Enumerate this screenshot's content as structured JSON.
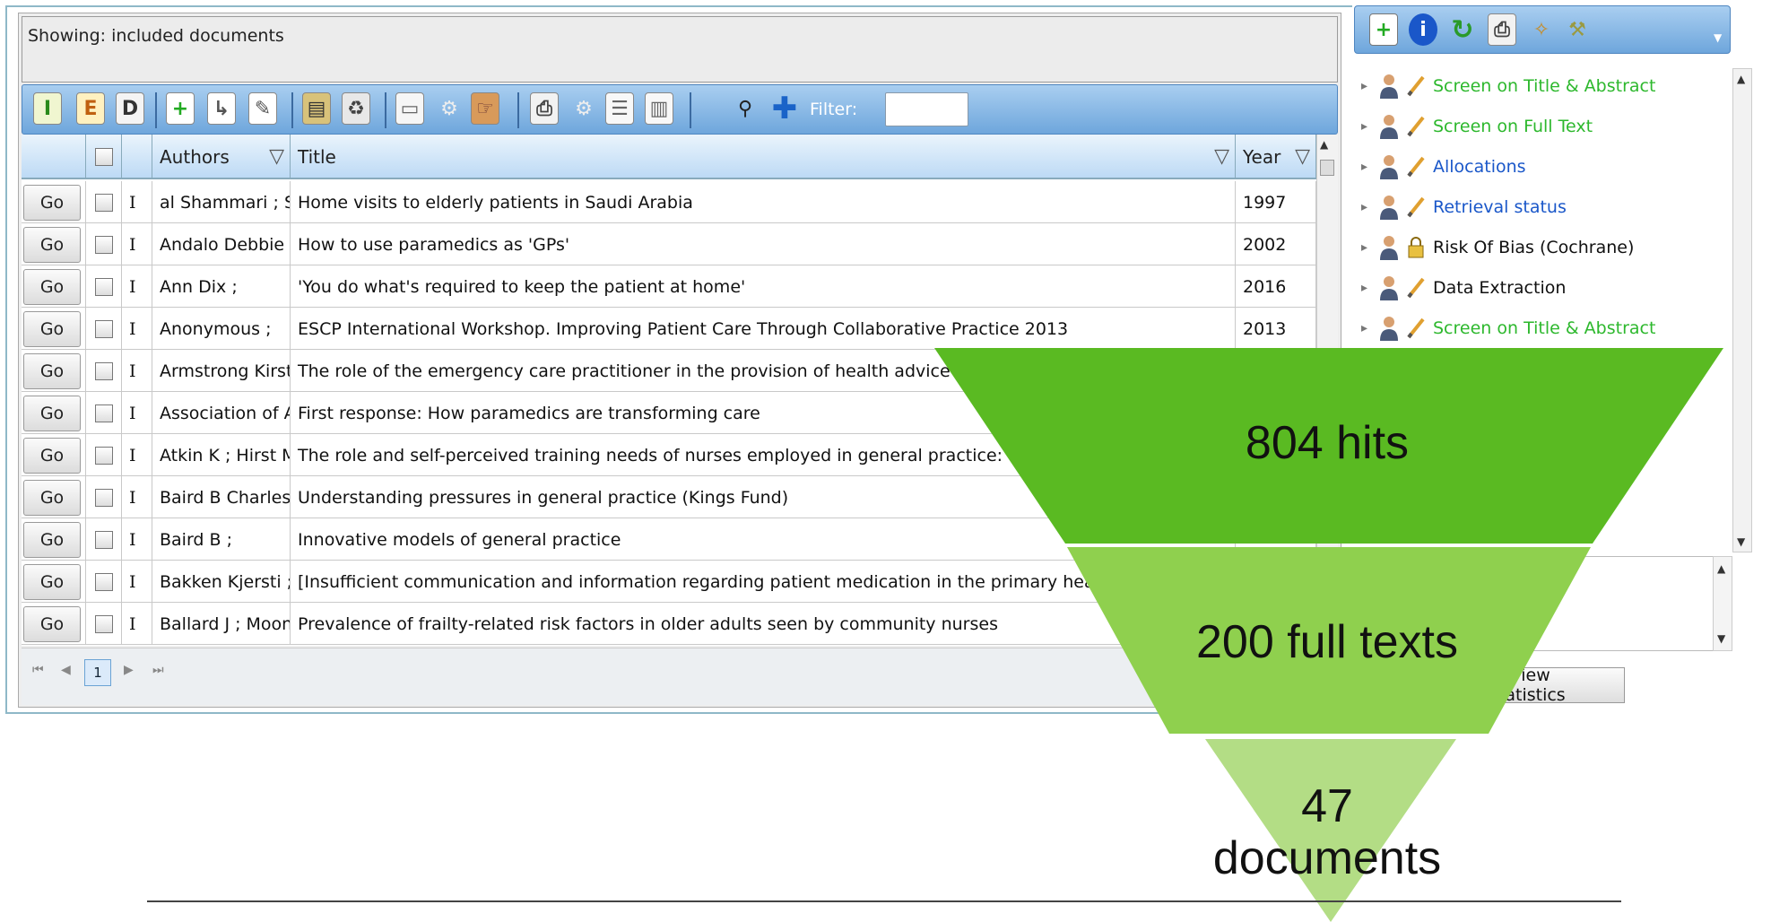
{
  "status": {
    "text": "Showing: included documents"
  },
  "toolbar": {
    "filter_label": "Filter:",
    "filter_value": ""
  },
  "columns": {
    "authors": "Authors",
    "title": "Title",
    "year": "Year"
  },
  "rows": [
    {
      "go": "Go",
      "type": "I",
      "authors": "al Shammari ; S",
      "title": "Home visits to elderly patients in Saudi Arabia",
      "year": "1997"
    },
    {
      "go": "Go",
      "type": "I",
      "authors": "Andalo Debbie ;",
      "title": "How to use paramedics as 'GPs'",
      "year": "2002"
    },
    {
      "go": "Go",
      "type": "I",
      "authors": "Ann Dix ;",
      "title": "'You do what's required to keep the patient at home'",
      "year": "2016"
    },
    {
      "go": "Go",
      "type": "I",
      "authors": "Anonymous  ;",
      "title": "ESCP International Workshop. Improving Patient Care Through Collaborative Practice 2013",
      "year": "2013"
    },
    {
      "go": "Go",
      "type": "I",
      "authors": "Armstrong Kirsty",
      "title": "The role of the emergency care practitioner in the provision of health advice and hea",
      "year": ""
    },
    {
      "go": "Go",
      "type": "I",
      "authors": "Association of Ar",
      "title": "First response: How paramedics are transforming care",
      "year": ""
    },
    {
      "go": "Go",
      "type": "I",
      "authors": "Atkin K ; Hirst M",
      "title": "The role and self-perceived training needs of nurses employed in general practice: observati",
      "year": ""
    },
    {
      "go": "Go",
      "type": "I",
      "authors": "Baird B Charles,",
      "title": "Understanding pressures in general practice (Kings Fund)",
      "year": ""
    },
    {
      "go": "Go",
      "type": "I",
      "authors": "Baird B ;",
      "title": "Innovative models of general practice",
      "year": ""
    },
    {
      "go": "Go",
      "type": "I",
      "authors": "Bakken Kjersti ;",
      "title": "[Insufficient communication and information regarding patient medication in the primary healthcare]",
      "year": ""
    },
    {
      "go": "Go",
      "type": "I",
      "authors": "Ballard J ; Moon",
      "title": "Prevalence of frailty-related risk factors in older adults seen by community nurses",
      "year": ""
    }
  ],
  "pager": {
    "current": "1"
  },
  "tree": [
    {
      "label": "Screen on Title & Abstract",
      "style": "green",
      "icon": "pencil-icon"
    },
    {
      "label": "Screen on Full Text",
      "style": "green",
      "icon": "pencil-icon"
    },
    {
      "label": "Allocations",
      "style": "blue",
      "icon": "pencil-icon"
    },
    {
      "label": "Retrieval status",
      "style": "blue",
      "icon": "pencil-icon"
    },
    {
      "label": "Risk Of Bias (Cochrane)",
      "style": "black",
      "icon": "lock-icon"
    },
    {
      "label": "Data Extraction",
      "style": "black",
      "icon": "pencil-icon"
    },
    {
      "label": "Screen on Title & Abstract",
      "style": "green",
      "icon": "pencil-icon"
    }
  ],
  "review_button": "Review statistics",
  "funnel": {
    "stage1": "804 hits",
    "stage2": "200 full texts",
    "stage3_line1": "47",
    "stage3_line2": "documents",
    "colors": [
      "#5aba22",
      "#8fd04e",
      "#b3dd85"
    ]
  },
  "colors": {
    "toolbar": "#6ea6dc",
    "green_link": "#2db82d",
    "blue_link": "#1a57c9"
  }
}
